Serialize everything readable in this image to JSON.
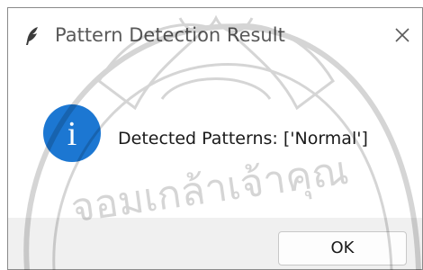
{
  "window": {
    "title": "Pattern Detection Result",
    "title_icon": "feather-icon",
    "close_glyph": "✕"
  },
  "dialog": {
    "icon": "info-icon",
    "icon_glyph": "i",
    "message": "Detected Patterns: ['Normal']"
  },
  "buttons": {
    "ok_label": "OK"
  },
  "watermark": {
    "text": "จอมเกล้าเจ้าคุณ"
  },
  "colors": {
    "info_blue": "#1c77d2",
    "titlebar": "#ffffff",
    "footer": "#f0f0f0"
  }
}
